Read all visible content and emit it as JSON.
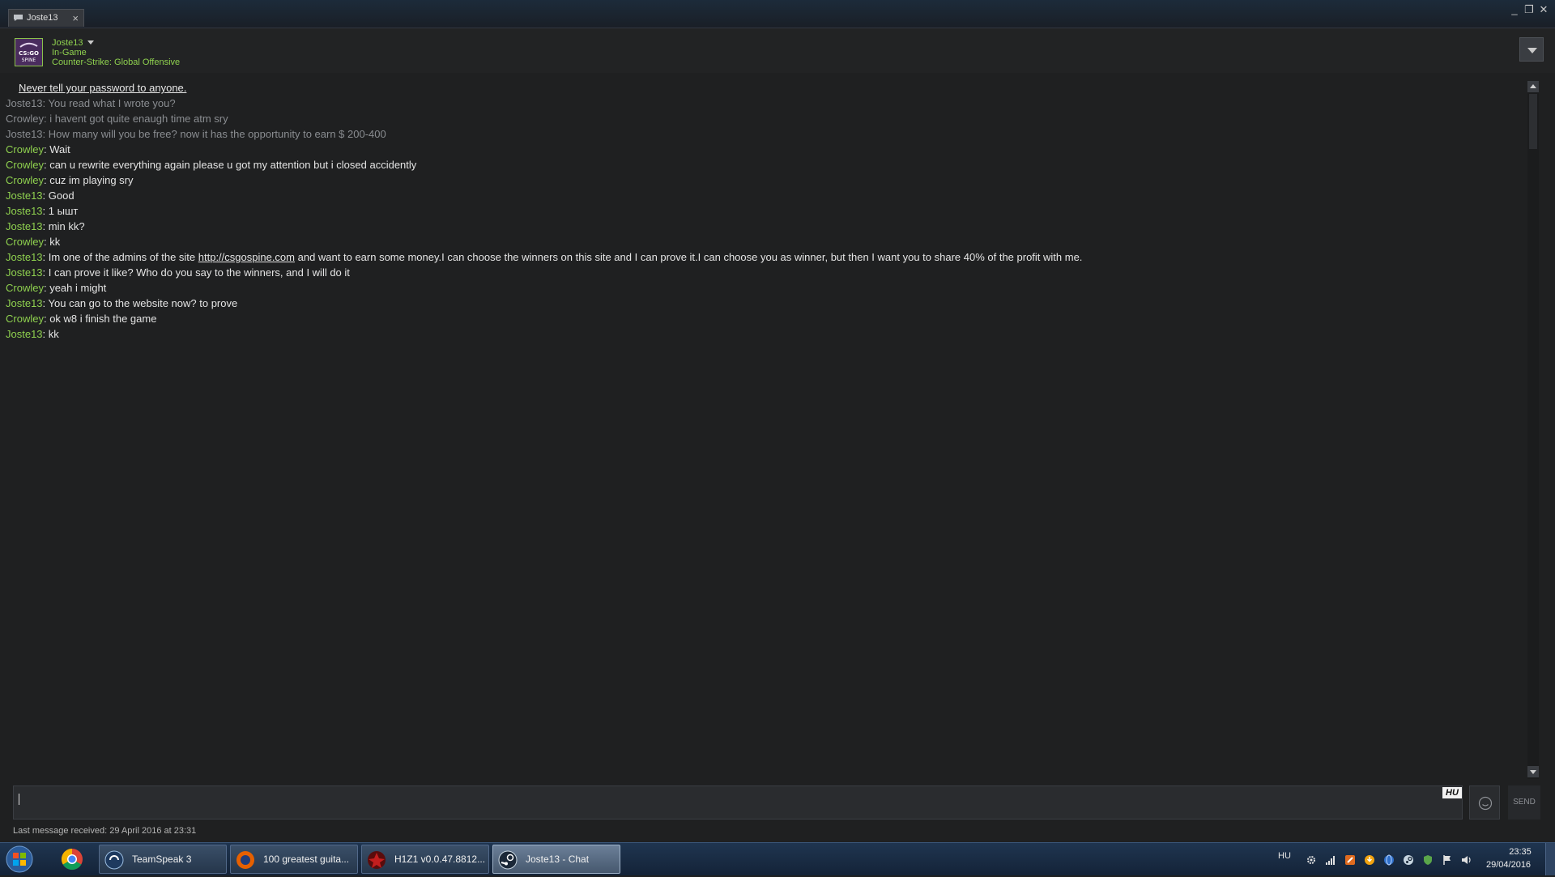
{
  "window": {
    "tab_label": "Joste13",
    "tab_close": "×",
    "minimize": "_",
    "maximize": "❐",
    "close": "✕"
  },
  "friend": {
    "name": "Joste13",
    "status": "In-Game",
    "game": "Counter-Strike: Global Offensive",
    "avatar_text": "CS:GO SPINE"
  },
  "chat": {
    "warning": "Never tell your password to anyone.",
    "messages": [
      {
        "who": "Joste13",
        "text": ": You read what I wrote you?"
      },
      {
        "who": "Crowley",
        "text": ": i havent got quite enaugh time atm sry"
      },
      {
        "who": "Joste13",
        "text": ": How many will you be free? now it has the opportunity to earn $ 200-400"
      },
      {
        "who": "Crowley",
        "text": ": Wait"
      },
      {
        "who": "Crowley",
        "text": ": can u rewrite everything again please u got my attention but i closed accidently"
      },
      {
        "who": "Crowley",
        "text": ": cuz im playing sry"
      },
      {
        "who": "Joste13",
        "text": ": Good"
      },
      {
        "who": "Joste13",
        "text": ": 1 ышт"
      },
      {
        "who": "Joste13",
        "text": ": min kk?"
      },
      {
        "who": "Crowley",
        "text": ": kk"
      },
      {
        "who": "Joste13",
        "text_before": ": Im one of the admins of the site ",
        "link": "http://csgospine.com",
        "text_after": " and want to earn some money.I can choose the winners on this site and I can prove it.I can choose you as winner, but then I want you to share 40% of the profit with me."
      },
      {
        "who": "Joste13",
        "text": ": I can prove it like? Who do you say to the winners, and I will do it"
      },
      {
        "who": "Crowley",
        "text": ": yeah i might"
      },
      {
        "who": "Joste13",
        "text": ": You can go to the website now? to prove"
      },
      {
        "who": "Crowley",
        "text": ": ok w8 i finish the game"
      },
      {
        "who": "Joste13",
        "text": ": kk"
      }
    ]
  },
  "input": {
    "value": "",
    "language_badge": "HU",
    "send_label": "SEND"
  },
  "footer": {
    "last_message": "Last message received: 29 April 2016 at 23:31"
  },
  "taskbar": {
    "buttons": [
      {
        "label": "TeamSpeak 3"
      },
      {
        "label": "100 greatest guita..."
      },
      {
        "label": "H1Z1 v0.0.47.8812..."
      },
      {
        "label": "Joste13 - Chat"
      }
    ],
    "language": "HU",
    "time": "23:35",
    "date": "29/04/2016"
  },
  "colors": {
    "friend_green": "#8fd14f",
    "old_message_grey": "#8a8d91",
    "background": "#1f2021"
  }
}
